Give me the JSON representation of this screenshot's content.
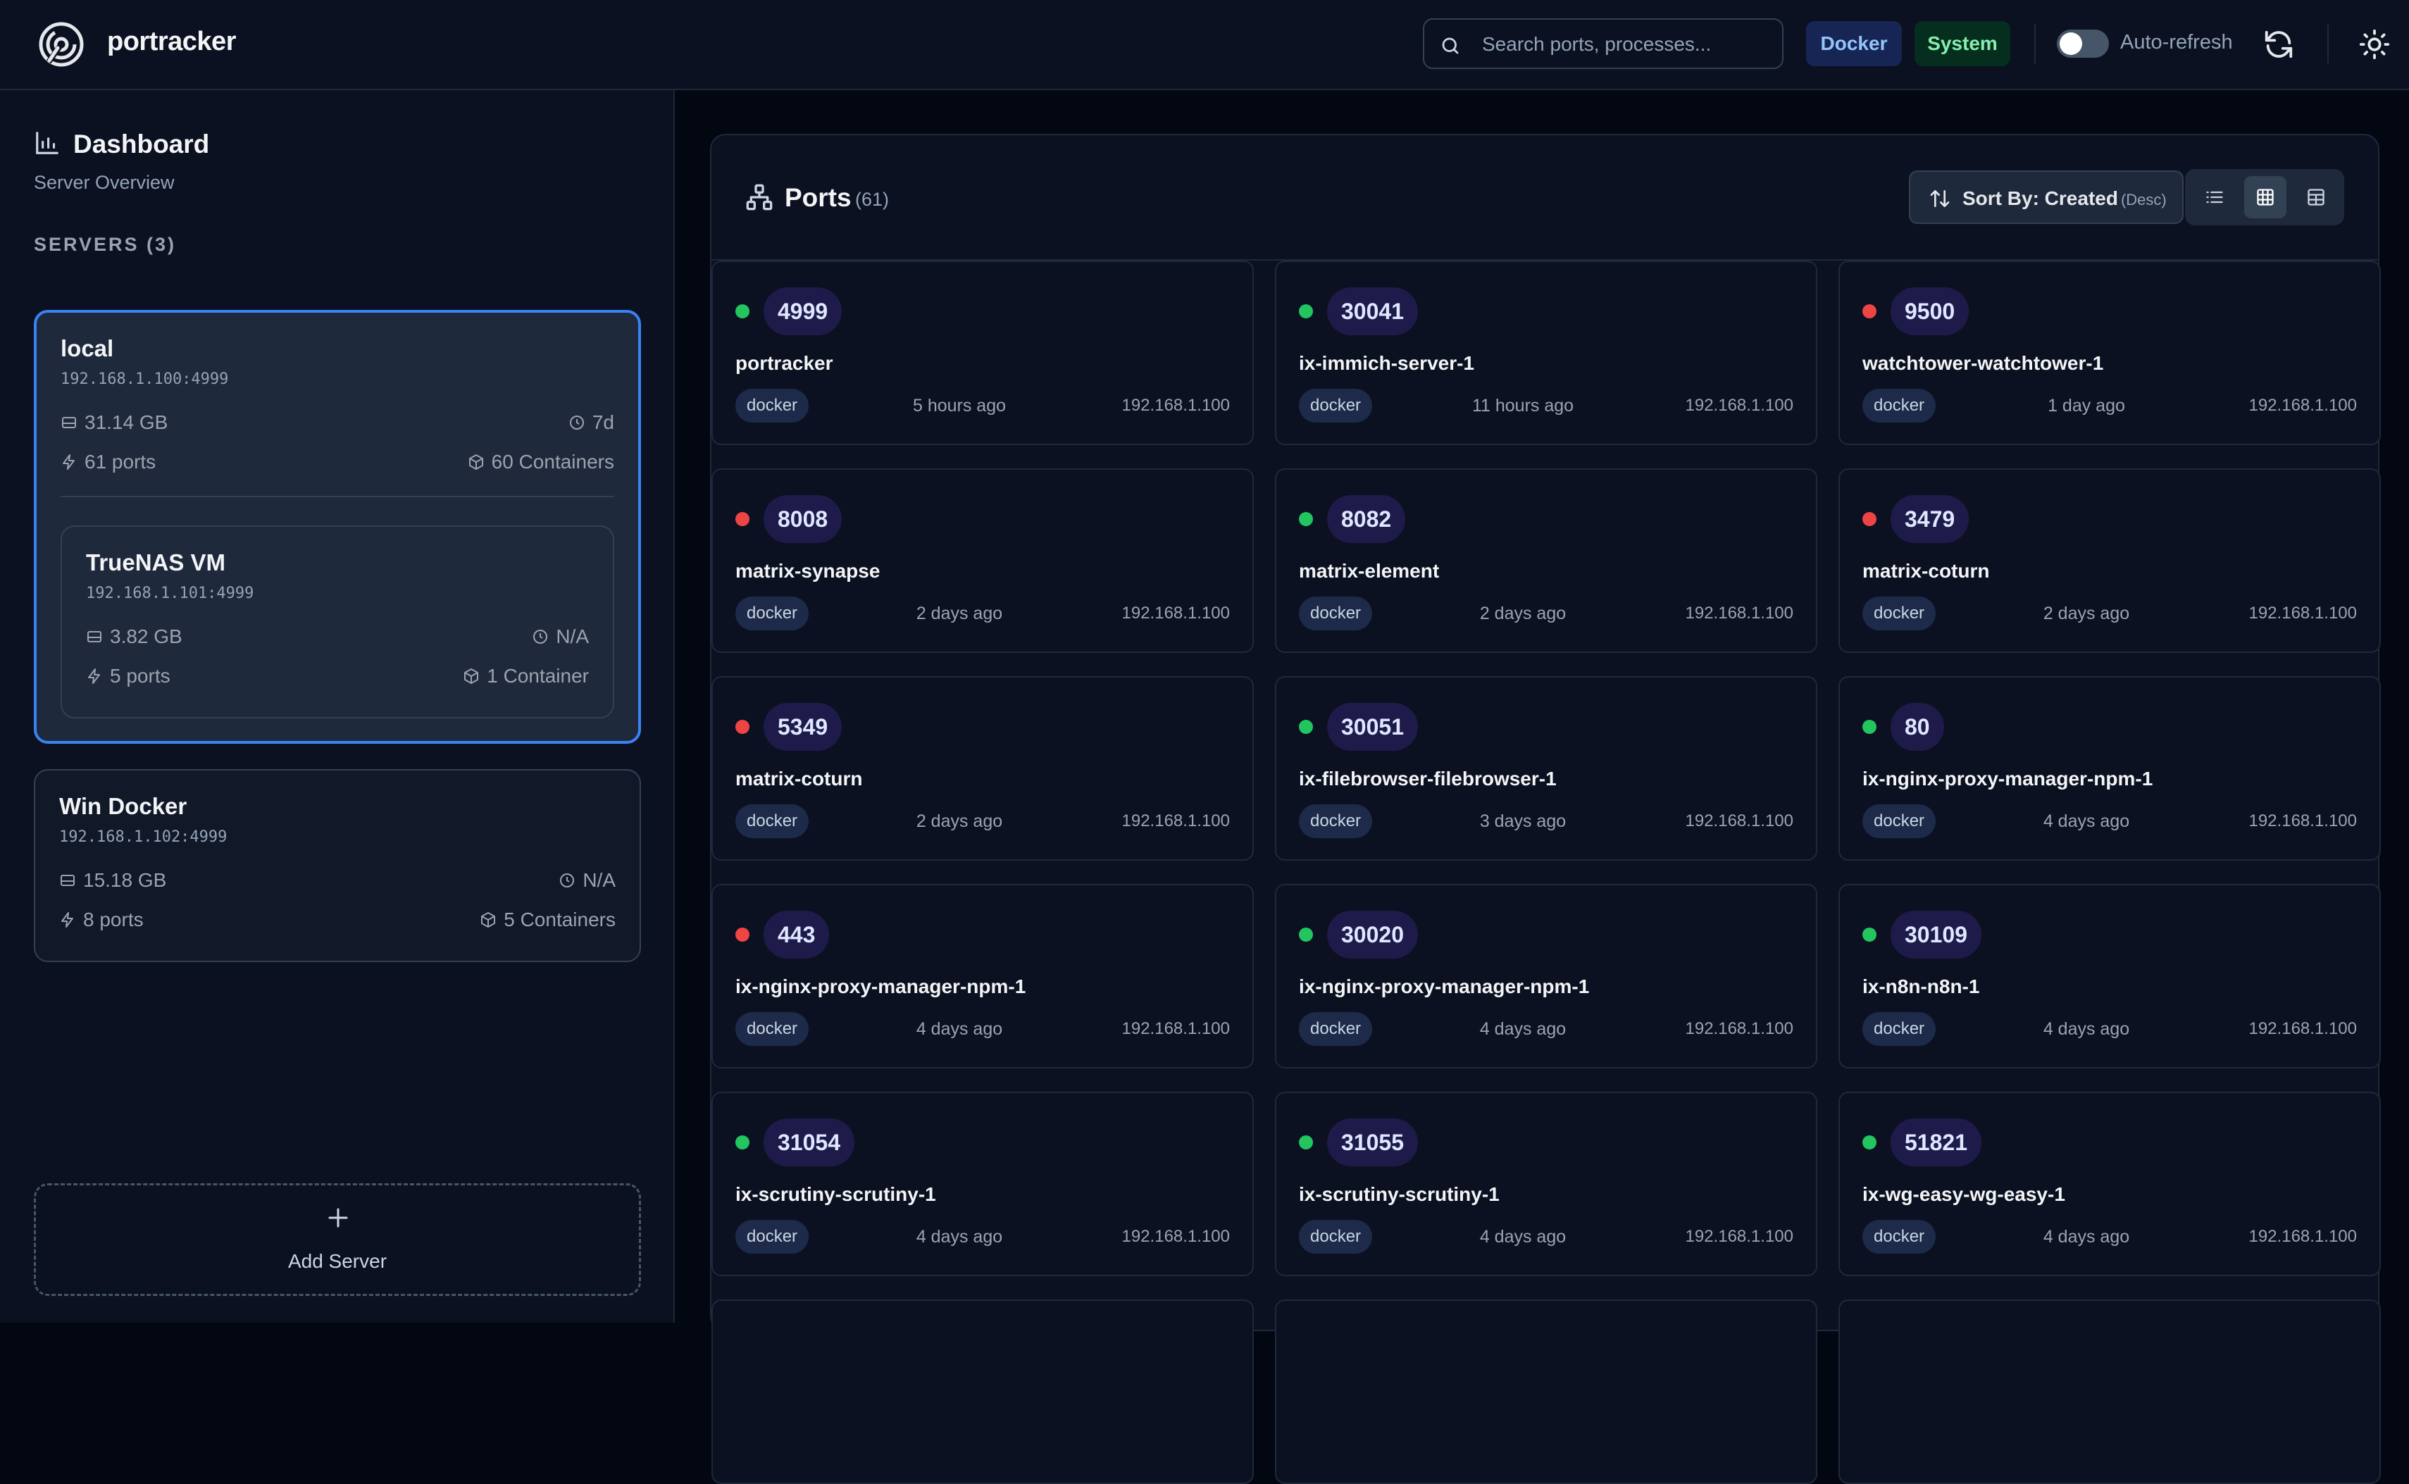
{
  "header": {
    "brand": "portracker",
    "search_placeholder": "Search ports, processes...",
    "filter_docker": "Docker",
    "filter_system": "System",
    "autorefresh_label": "Auto-refresh"
  },
  "sidebar": {
    "title": "Dashboard",
    "subtitle": "Server Overview",
    "servers_label": "SERVERS (3)",
    "servers": [
      {
        "name": "local",
        "address": "192.168.1.100:4999",
        "storage": "31.14 GB",
        "uptime": "7d",
        "ports": "61 ports",
        "containers": "60 Containers"
      },
      {
        "name": "TrueNAS VM",
        "address": "192.168.1.101:4999",
        "storage": "3.82 GB",
        "uptime": "N/A",
        "ports": "5 ports",
        "containers": "1 Container"
      },
      {
        "name": "Win Docker",
        "address": "192.168.1.102:4999",
        "storage": "15.18 GB",
        "uptime": "N/A",
        "ports": "8 ports",
        "containers": "5 Containers"
      }
    ],
    "add_server": "Add Server"
  },
  "main": {
    "title": "Ports",
    "count": "(61)",
    "sort_label": "Sort By: Created",
    "sort_dir": "(Desc)",
    "ports": [
      {
        "port": "4999",
        "status": "up",
        "name": "portracker",
        "source": "docker",
        "time": "5 hours ago",
        "ip": "192.168.1.100"
      },
      {
        "port": "30041",
        "status": "up",
        "name": "ix-immich-server-1",
        "source": "docker",
        "time": "11 hours ago",
        "ip": "192.168.1.100"
      },
      {
        "port": "9500",
        "status": "down",
        "name": "watchtower-watchtower-1",
        "source": "docker",
        "time": "1 day ago",
        "ip": "192.168.1.100"
      },
      {
        "port": "8008",
        "status": "down",
        "name": "matrix-synapse",
        "source": "docker",
        "time": "2 days ago",
        "ip": "192.168.1.100"
      },
      {
        "port": "8082",
        "status": "up",
        "name": "matrix-element",
        "source": "docker",
        "time": "2 days ago",
        "ip": "192.168.1.100"
      },
      {
        "port": "3479",
        "status": "down",
        "name": "matrix-coturn",
        "source": "docker",
        "time": "2 days ago",
        "ip": "192.168.1.100"
      },
      {
        "port": "5349",
        "status": "down",
        "name": "matrix-coturn",
        "source": "docker",
        "time": "2 days ago",
        "ip": "192.168.1.100"
      },
      {
        "port": "30051",
        "status": "up",
        "name": "ix-filebrowser-filebrowser-1",
        "source": "docker",
        "time": "3 days ago",
        "ip": "192.168.1.100"
      },
      {
        "port": "80",
        "status": "up",
        "name": "ix-nginx-proxy-manager-npm-1",
        "source": "docker",
        "time": "4 days ago",
        "ip": "192.168.1.100"
      },
      {
        "port": "443",
        "status": "down",
        "name": "ix-nginx-proxy-manager-npm-1",
        "source": "docker",
        "time": "4 days ago",
        "ip": "192.168.1.100"
      },
      {
        "port": "30020",
        "status": "up",
        "name": "ix-nginx-proxy-manager-npm-1",
        "source": "docker",
        "time": "4 days ago",
        "ip": "192.168.1.100"
      },
      {
        "port": "30109",
        "status": "up",
        "name": "ix-n8n-n8n-1",
        "source": "docker",
        "time": "4 days ago",
        "ip": "192.168.1.100"
      },
      {
        "port": "31054",
        "status": "up",
        "name": "ix-scrutiny-scrutiny-1",
        "source": "docker",
        "time": "4 days ago",
        "ip": "192.168.1.100"
      },
      {
        "port": "31055",
        "status": "up",
        "name": "ix-scrutiny-scrutiny-1",
        "source": "docker",
        "time": "4 days ago",
        "ip": "192.168.1.100"
      },
      {
        "port": "51821",
        "status": "up",
        "name": "ix-wg-easy-wg-easy-1",
        "source": "docker",
        "time": "4 days ago",
        "ip": "192.168.1.100"
      }
    ]
  },
  "colors": {
    "accent": "#3b82f6",
    "status_up": "#22c55e",
    "status_down": "#ef4444"
  }
}
